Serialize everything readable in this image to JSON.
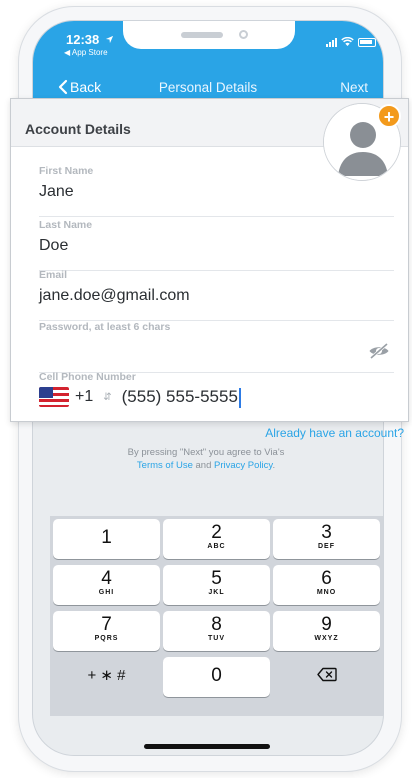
{
  "status_bar": {
    "time": "12:38",
    "back_app": "◀ App Store"
  },
  "nav": {
    "back_label": "Back",
    "title": "Personal Details",
    "next_label": "Next"
  },
  "card": {
    "title": "Account Details",
    "fields": {
      "first_name": {
        "label": "First Name",
        "value": "Jane"
      },
      "last_name": {
        "label": "Last Name",
        "value": "Doe"
      },
      "email": {
        "label": "Email",
        "value": "jane.doe@gmail.com"
      },
      "password": {
        "label": "Password, at least 6 chars",
        "value": ""
      },
      "cell_phone": {
        "label": "Cell Phone Number",
        "country_code": "+1",
        "value": "(555) 555-5555"
      }
    },
    "already_link": "Already have an account?"
  },
  "agreement": {
    "line1": "By pressing \"Next\" you agree to Via's",
    "terms": "Terms of Use",
    "and": " and ",
    "privacy": "Privacy Policy",
    "period": "."
  },
  "keypad": {
    "keys": [
      {
        "num": "1",
        "letters": ""
      },
      {
        "num": "2",
        "letters": "ABC"
      },
      {
        "num": "3",
        "letters": "DEF"
      },
      {
        "num": "4",
        "letters": "GHI"
      },
      {
        "num": "5",
        "letters": "JKL"
      },
      {
        "num": "6",
        "letters": "MNO"
      },
      {
        "num": "7",
        "letters": "PQRS"
      },
      {
        "num": "8",
        "letters": "TUV"
      },
      {
        "num": "9",
        "letters": "WXYZ"
      },
      {
        "num": "+ ∗ #",
        "letters": ""
      },
      {
        "num": "0",
        "letters": ""
      },
      {
        "num": "⌫",
        "letters": ""
      }
    ]
  },
  "colors": {
    "accent": "#2aa4e6",
    "avatar_badge": "#f39a1c"
  },
  "icons": [
    "location-arrow-icon",
    "signal-icon",
    "wifi-icon",
    "battery-icon",
    "chevron-left-icon",
    "user-avatar-icon",
    "plus-icon",
    "eye-slash-icon",
    "us-flag-icon",
    "up-down-icon",
    "backspace-icon"
  ]
}
